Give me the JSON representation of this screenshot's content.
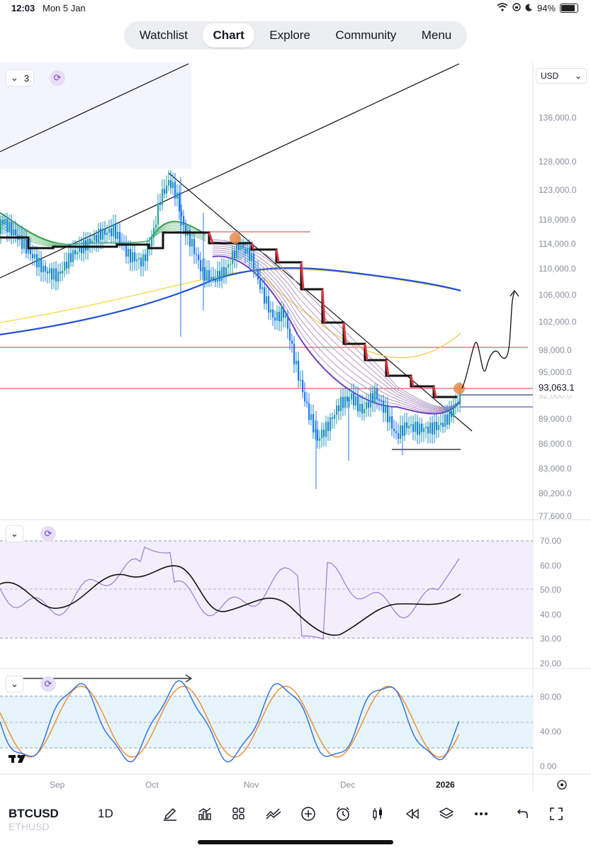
{
  "status": {
    "time": "12:03",
    "date": "Mon 5 Jan",
    "battery": "94%"
  },
  "nav": {
    "tabs": [
      "Watchlist",
      "Chart",
      "Explore",
      "Community",
      "Menu"
    ],
    "active": "Chart"
  },
  "pane_controls": {
    "main_count": "3"
  },
  "currency": "USD",
  "price_axis": [
    "136,000.0",
    "128,000.0",
    "123,000.0",
    "118,000.0",
    "114,000.0",
    "110,000.0",
    "106,000.0",
    "102,000.0",
    "98,000.0",
    "95,000.0",
    "92,000.0",
    "89,000.0",
    "86,000.0",
    "83,000.0",
    "80,200.0",
    "77,600.0"
  ],
  "last_price": "93,063.1",
  "rsi_axis": [
    "70.00",
    "60.00",
    "50.00",
    "40.00",
    "30.00",
    "20.00"
  ],
  "stoch_axis": [
    "80.00",
    "40.00",
    "0.00"
  ],
  "time_axis": [
    "Sep",
    "Oct",
    "Nov",
    "Dec",
    "2026"
  ],
  "bottom": {
    "symbol": "BTCUSD",
    "symbol_secondary": "ETHUSD",
    "timeframe": "1D"
  },
  "colors": {
    "accent": "#2962ff",
    "candle_up": "#26a69a",
    "candle_down": "#1f77ff",
    "rsi": "#9b7cd4",
    "stoch_k": "#2a6de0",
    "stoch_d": "#f08a2c",
    "pink_band": "#f3eefb",
    "blue_band": "#e6f4fc",
    "red_level": "#e0343f"
  },
  "icons": [
    "draw-icon",
    "indicators-icon",
    "layouts-icon",
    "compare-icon",
    "add-icon",
    "alert-icon",
    "candles-icon",
    "replay-icon",
    "layers-icon",
    "more-icon",
    "undo-icon",
    "fullscreen-icon",
    "settings-icon"
  ]
}
